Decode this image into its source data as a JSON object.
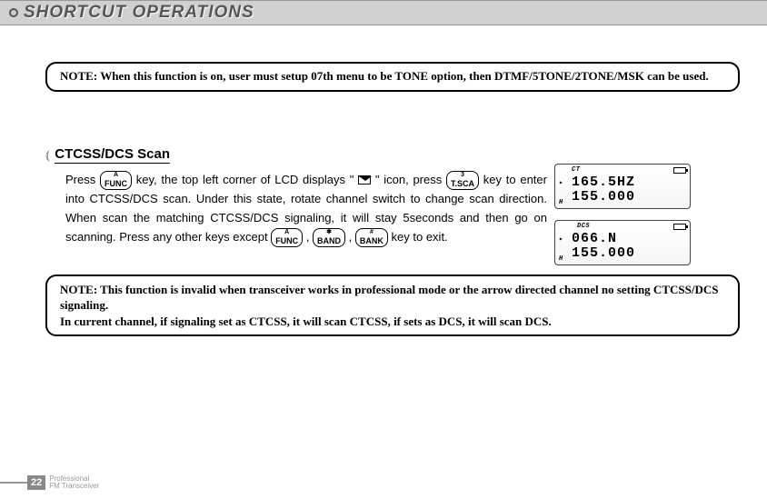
{
  "header": {
    "title": "SHORTCUT OPERATIONS"
  },
  "note1": {
    "prefix": "NOTE: ",
    "text": "When this function is on, user must setup 07th menu to be TONE option, then DTMF/5TONE/2TONE/MSK can be used."
  },
  "section": {
    "title": "CTCSS/DCS Scan",
    "body_part1": "Press ",
    "key_func": "A FUNC",
    "body_part2": " key, the top left corner of LCD displays \" ",
    "body_part3": " \" icon, press ",
    "key_tsca": "3 T.SCA",
    "body_part4": " key to enter into CTCSS/DCS scan. Under this state, rotate channel switch to change scan direction. When scan the matching CTCSS/DCS signaling, it will stay 5seconds and then go on scanning. Press any other keys except ",
    "key_band": "✱ BAND",
    "key_bank": "# BANK",
    "body_part5": " key to exit."
  },
  "lcd1": {
    "tag": "CT",
    "line1": "165.5HZ",
    "line2": "155.000"
  },
  "lcd2": {
    "tag": "DCS",
    "line1": "066.N",
    "line2": "155.000"
  },
  "note2": {
    "line1": "NOTE: This function is invalid when transceiver works in professional mode or the arrow directed channel no setting CTCSS/DCS signaling.",
    "line2": "In current channel, if signaling set as CTCSS, it will scan CTCSS, if sets as DCS, it will scan DCS."
  },
  "footer": {
    "page": "22",
    "line1": "Professional",
    "line2": "FM Transceiver"
  }
}
